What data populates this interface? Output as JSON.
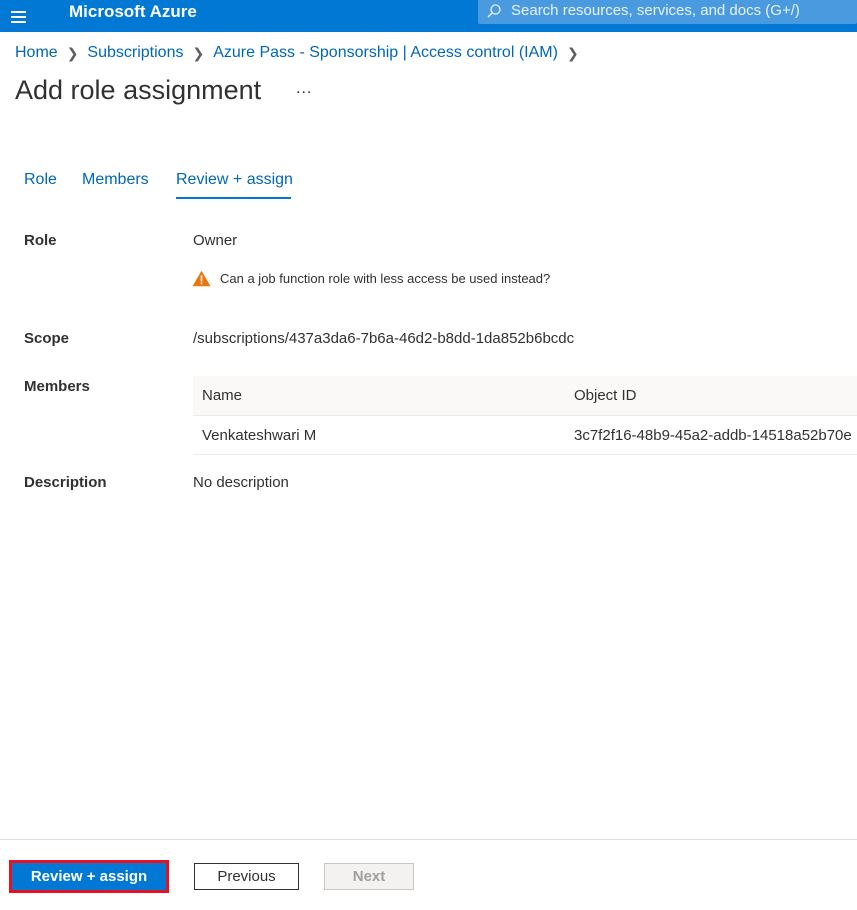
{
  "topbar": {
    "brand": "Microsoft Azure",
    "search_placeholder": "Search resources, services, and docs (G+/)",
    "accent": "#0078d4"
  },
  "breadcrumb": [
    "Home",
    "Subscriptions",
    "Azure Pass - Sponsorship | Access control (IAM)"
  ],
  "page": {
    "title": "Add role assignment",
    "more": "..."
  },
  "tabs": [
    {
      "label": "Role",
      "active": false
    },
    {
      "label": "Members",
      "active": false
    },
    {
      "label": "Review + assign",
      "active": true
    }
  ],
  "review": {
    "role_label": "Role",
    "role_value": "Owner",
    "warning": "Can a job function role with less access be used instead?",
    "scope_label": "Scope",
    "scope_value": "/subscriptions/437a3da6-7b6a-46d2-b8dd-1da852b6bcdc",
    "members_label": "Members",
    "members_columns": [
      "Name",
      "Object ID"
    ],
    "members_rows": [
      {
        "name": "Venkateshwari M",
        "object_id": "3c7f2f16-48b9-45a2-addb-14518a52b70e"
      }
    ],
    "description_label": "Description",
    "description_value": "No description"
  },
  "footer": {
    "primary": "Review + assign",
    "previous": "Previous",
    "next": "Next"
  },
  "icons": {
    "menu": "hamburger-menu-icon",
    "search": "search-icon",
    "warning": "warning-triangle-icon"
  }
}
